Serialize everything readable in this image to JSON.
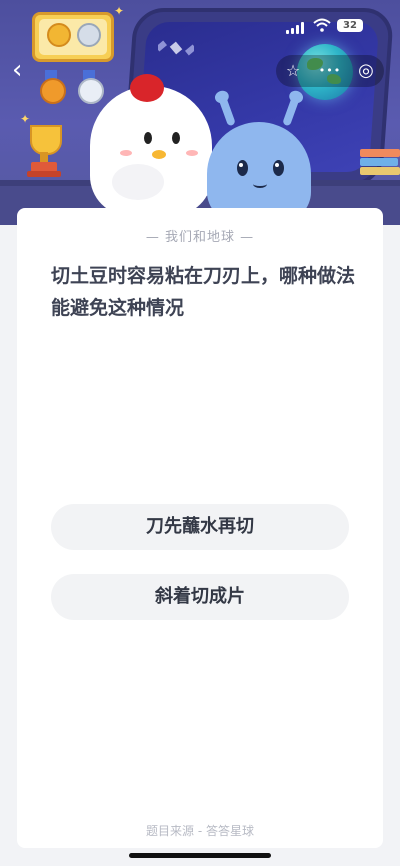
{
  "status_bar": {
    "battery": "32"
  },
  "nav": {
    "back_glyph": "‹",
    "star_glyph": "☆",
    "more_glyph": "•••",
    "target_glyph": "◎"
  },
  "card": {
    "section_title": "— 我们和地球 —",
    "question": "切土豆时容易粘在刀刃上，哪种做法能避免这种情况",
    "options": [
      {
        "label": "刀先蘸水再切"
      },
      {
        "label": "斜着切成片"
      }
    ],
    "source": "题目来源 - 答答星球"
  },
  "colors": {
    "hero": "#5a5bb0",
    "option_bg": "#f2f3f5",
    "question_text": "#3e4354"
  }
}
